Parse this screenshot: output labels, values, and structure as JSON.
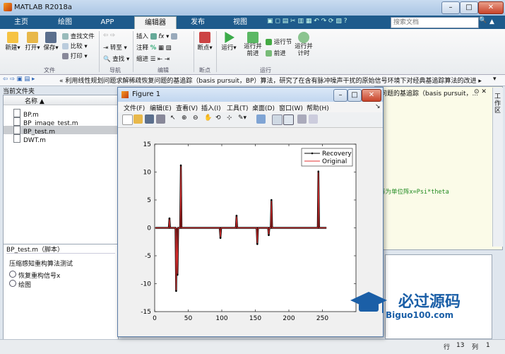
{
  "window": {
    "title": "MATLAB R2018a"
  },
  "tabs": [
    {
      "label": "主页"
    },
    {
      "label": "绘图"
    },
    {
      "label": "APP"
    },
    {
      "label": "编辑器"
    },
    {
      "label": "发布"
    },
    {
      "label": "视图"
    }
  ],
  "search": {
    "placeholder": "搜索文档"
  },
  "ribbon": {
    "file": {
      "new": "新建",
      "open": "打开",
      "save": "保存",
      "find_files": "查找文件",
      "compare": "比较",
      "print": "打印",
      "group": "文件"
    },
    "nav": {
      "goto": "转至",
      "find": "查找",
      "group": "导航"
    },
    "edit": {
      "insert": "插入",
      "comment": "注释",
      "indent": "缩进",
      "group": "编辑",
      "fx": "fx"
    },
    "breakpoints": {
      "label": "断点",
      "group": "断点"
    },
    "run": {
      "run": "运行",
      "run_advance": "运行并前进",
      "run_section": "运行节",
      "advance": "前进",
      "run_time": "运行并计时",
      "group": "运行"
    }
  },
  "path": {
    "text": "« 利用线性规划问题求解稀疏恢复问题的基追踪（basis pursuit，BP）算法，研究了在含有脉冲噪声干扰的原始信号环境下对经典基追踪算法的改进 ▸ BP"
  },
  "current_folder": {
    "title": "当前文件夹",
    "column": "名称 ▲",
    "files": [
      {
        "name": "BP.m",
        "selected": false
      },
      {
        "name": "BP_image_test.m",
        "selected": false
      },
      {
        "name": "BP_test.m",
        "selected": true
      },
      {
        "name": "DWT.m",
        "selected": false
      }
    ]
  },
  "details": {
    "title": "BP_test.m（脚本）",
    "desc": "压缩感知重构算法测试",
    "items": [
      {
        "label": "恢复重构信号x"
      },
      {
        "label": "绘图"
      }
    ]
  },
  "editor": {
    "snippet_top": "问题的基追踪（basis pursuit，...",
    "snippet_code": "阵为单位阵x=Psi*theta",
    "workspace_tab": "工作区"
  },
  "status": {
    "line_label": "行",
    "line": "13",
    "col_label": "列",
    "col": "1"
  },
  "figure": {
    "title": "Figure 1",
    "menu": [
      "文件(F)",
      "编辑(E)",
      "查看(V)",
      "插入(I)",
      "工具(T)",
      "桌面(D)",
      "窗口(W)",
      "帮助(H)"
    ]
  },
  "chart_data": {
    "type": "line",
    "title": "",
    "xlabel": "",
    "ylabel": "",
    "xlim": [
      0,
      300
    ],
    "ylim": [
      -15,
      15
    ],
    "xticks": [
      0,
      50,
      100,
      150,
      200,
      250
    ],
    "yticks": [
      -15,
      -10,
      -5,
      0,
      5,
      10,
      15
    ],
    "legend_position": "top-right",
    "series": [
      {
        "name": "Recovery",
        "color": "#000000",
        "spikes": [
          [
            22,
            1.7
          ],
          [
            32,
            -11.3
          ],
          [
            34,
            -8.4
          ],
          [
            39,
            11.2
          ],
          [
            98,
            -1.8
          ],
          [
            122,
            2.2
          ],
          [
            153,
            -2.9
          ],
          [
            170,
            -1.3
          ],
          [
            174,
            5.0
          ],
          [
            244,
            10.1
          ]
        ]
      },
      {
        "name": "Original",
        "color": "#e03030",
        "spikes": [
          [
            22,
            1.7
          ],
          [
            32,
            -11.3
          ],
          [
            34,
            -8.4
          ],
          [
            39,
            11.2
          ],
          [
            98,
            -1.8
          ],
          [
            122,
            2.2
          ],
          [
            153,
            -2.9
          ],
          [
            170,
            -1.3
          ],
          [
            174,
            5.0
          ],
          [
            244,
            10.1
          ]
        ]
      }
    ]
  },
  "watermark": {
    "cn": "必过源码",
    "url": "Biguo100.com"
  }
}
